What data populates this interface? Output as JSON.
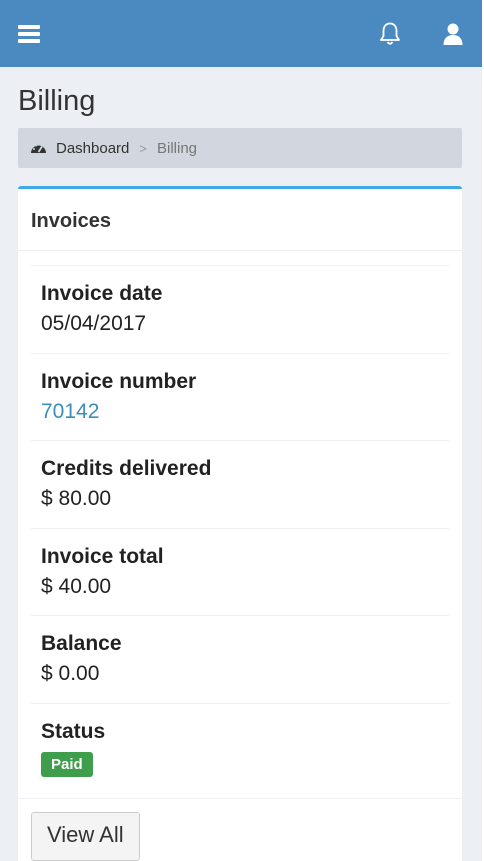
{
  "header": {
    "menu_icon": "hamburger-menu-icon",
    "notifications_icon": "bell-icon",
    "user_icon": "user-icon"
  },
  "page": {
    "title": "Billing"
  },
  "breadcrumb": {
    "home_icon": "dashboard-gauge-icon",
    "home": "Dashboard",
    "separator": ">",
    "current": "Billing"
  },
  "invoices": {
    "title": "Invoices",
    "fields": [
      {
        "label": "Invoice date",
        "value": "05/04/2017"
      },
      {
        "label": "Invoice number",
        "value": "70142"
      },
      {
        "label": "Credits delivered",
        "value": "$ 80.00"
      },
      {
        "label": "Invoice total",
        "value": "$ 40.00"
      },
      {
        "label": "Balance",
        "value": "$ 0.00"
      },
      {
        "label": "Status",
        "value": "Paid"
      }
    ],
    "view_all_label": "View All"
  },
  "colors": {
    "topbar": "#4b8ac0",
    "box_accent": "#3fa9e5",
    "link": "#3c8dbc",
    "paid_badge": "#3e9e4b",
    "background": "#ecf0f5"
  }
}
